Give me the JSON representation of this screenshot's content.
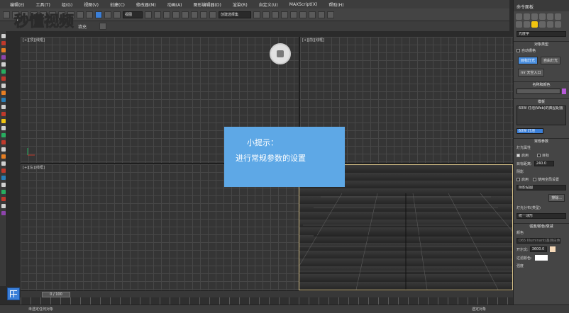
{
  "menu": {
    "items": [
      "编辑(E)",
      "工具(T)",
      "组(G)",
      "视图(V)",
      "创建(C)",
      "修改器(M)",
      "动画(A)",
      "图形编辑器(D)",
      "渲染(R)",
      "自定义(U)",
      "MAXScript(X)",
      "帮助(H)"
    ]
  },
  "toolbar": {
    "view_dropdown": "视图",
    "selection_set_placeholder": "创建选择集"
  },
  "row2": {
    "fill_label": "填充"
  },
  "logo": {
    "text": "秒懂视频"
  },
  "viewports": {
    "top_left": "[+][顶][线框]",
    "top_right": "[+][前][线框]",
    "bottom_left": "[+][左][线框]"
  },
  "hint": {
    "title": "小提示：",
    "body": "进行常规参数的设置"
  },
  "panel": {
    "header": "命令面板",
    "category_dropdown": "光度学",
    "object_type_title": "对象类型",
    "auto_grid": "自动栅格",
    "target_light_btn": "目标灯光",
    "free_light_btn": "自由灯光",
    "sky_portal_btn": "mr 天空入口",
    "name_color_title": "名称和颜色",
    "template_title": "模板",
    "template_text": "60W 灯泡(Web)的典型配置",
    "template_dropdown": "60W 灯泡",
    "general_params_title": "常规参数",
    "light_props": "灯光属性",
    "enabled_label": "启用",
    "targeted_label": "目标",
    "target_distance_label": "目标距离:",
    "target_distance_value": "240.0",
    "shadows_label": "阴影",
    "shadow_enabled": "启用",
    "use_global": "使用全局设置",
    "shadow_type": "阴影贴图",
    "exclude_btn": "排除...",
    "distribution_label": "灯光分布(类型)",
    "distribution_value": "统一球形",
    "intensity_title": "强度/颜色/衰减",
    "color_label": "颜色",
    "color_preset": "D65 Illuminant(基准白色)",
    "kelvin_label": "开尔文:",
    "kelvin_value": "3600.0",
    "filter_color_label": "过滤颜色:",
    "intensity_label": "强度"
  },
  "timeline": {
    "slider_label": "0 / 100"
  },
  "status": {
    "text": "未选定任何对象",
    "keyfilter": "选定对象"
  },
  "colors": {
    "accent_blue": "#3b7fd8",
    "hint_bg": "#5ea8e6",
    "perspective_border": "#d9c38a"
  }
}
